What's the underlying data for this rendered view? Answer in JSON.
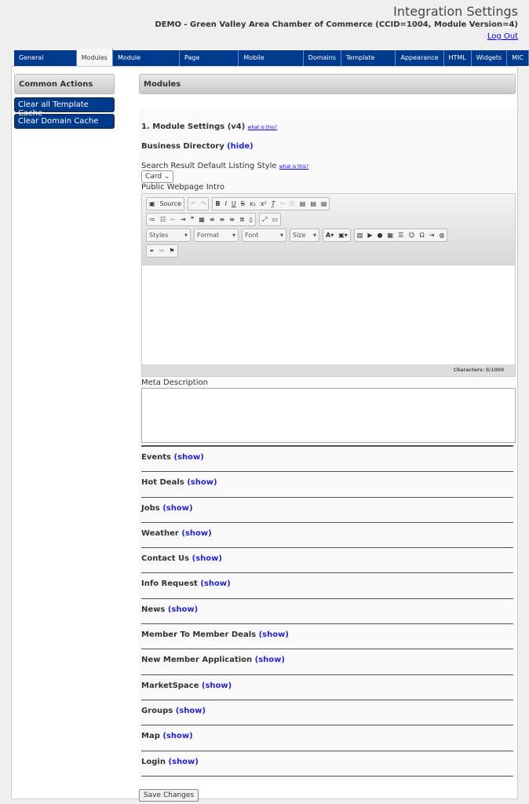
{
  "header": {
    "title": "Integration Settings",
    "subtitle": "DEMO - Green Valley Area Chamber of Commerce (CCID=1004, Module Version=4)",
    "logout": "Log Out"
  },
  "tabs": [
    "General Settings",
    "Modules",
    "Module Templates",
    "Page Templates",
    "Mobile Templates",
    "Domains",
    "Template Tags",
    "Appearance",
    "HTML",
    "Widgets",
    "MIC"
  ],
  "active_tab": "Modules",
  "sidebar": {
    "title": "Common Actions",
    "actions": [
      "Clear all Template Cache",
      "Clear Domain Cache"
    ]
  },
  "main": {
    "title": "Modules",
    "settings_title": "1. Module Settings (v4)",
    "what_is_this": "what is this?",
    "business_directory": "Business Directory",
    "hide": "(hide)",
    "listing_style_label": "Search Result Default Listing Style",
    "listing_style_value": "Card",
    "intro_label": "Public Webpage Intro",
    "source": "Source",
    "dropdowns": [
      "Styles",
      "Format",
      "Font",
      "Size"
    ],
    "characters": "Characters: 0/1000",
    "meta_label": "Meta Description",
    "show": "(show)",
    "sections": [
      "Events",
      "Hot Deals",
      "Jobs",
      "Weather",
      "Contact Us",
      "Info Request",
      "News",
      "Member To Member Deals",
      "New Member Application",
      "MarketSpace",
      "Groups",
      "Map",
      "Login"
    ],
    "save": "Save Changes"
  }
}
